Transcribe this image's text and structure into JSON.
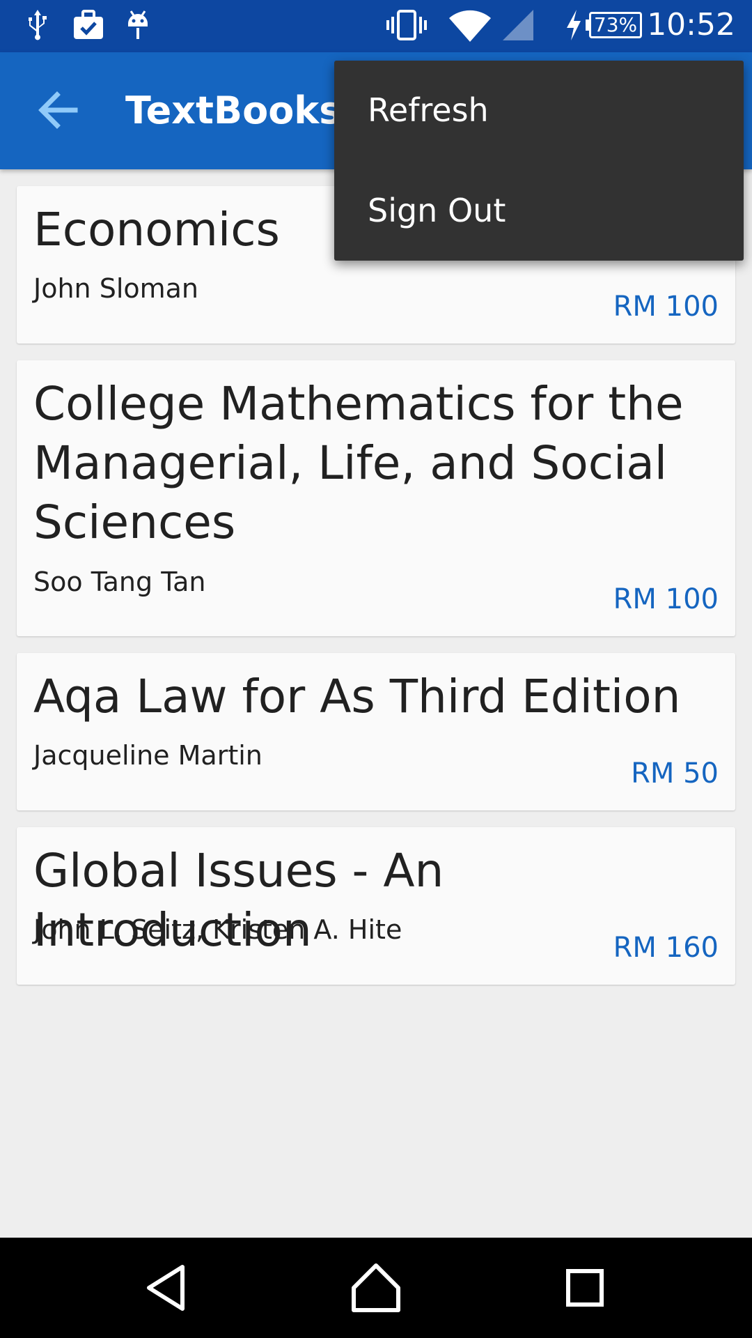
{
  "status_bar": {
    "time": "10:52",
    "battery": "73%",
    "left_icons": [
      "usb-icon",
      "briefcase-check-icon",
      "android-debug-icon"
    ],
    "right_icons": [
      "vibrate-icon",
      "wifi-icon",
      "cell-signal-icon",
      "charging-bolt-icon",
      "battery-icon"
    ]
  },
  "app_bar": {
    "title": "TextBooks",
    "back_icon": "arrow-left-icon",
    "color": "#1565c0"
  },
  "overflow_menu": {
    "items": [
      {
        "label": "Refresh"
      },
      {
        "label": "Sign Out"
      }
    ]
  },
  "books": [
    {
      "title": "Economics",
      "author": "John Sloman",
      "price": "RM 100"
    },
    {
      "title": "College Mathematics for the Managerial, Life, and Social Sciences",
      "author": "Soo Tang Tan",
      "price": "RM 100"
    },
    {
      "title": "Aqa Law for As Third Edition",
      "author": "Jacqueline Martin",
      "price": "RM 50"
    },
    {
      "title": "Global Issues - An Introduction",
      "author": "John L. Seitz, Kristen A. Hite",
      "price": "RM 160"
    }
  ],
  "nav_bar": {
    "icons": [
      "back-triangle-icon",
      "home-icon",
      "recents-icon"
    ]
  },
  "colors": {
    "status_bar": "#0d47a1",
    "accent": "#1565c0",
    "menu_bg": "#323232",
    "card_bg": "#fafafa",
    "page_bg": "#eeeeee"
  }
}
